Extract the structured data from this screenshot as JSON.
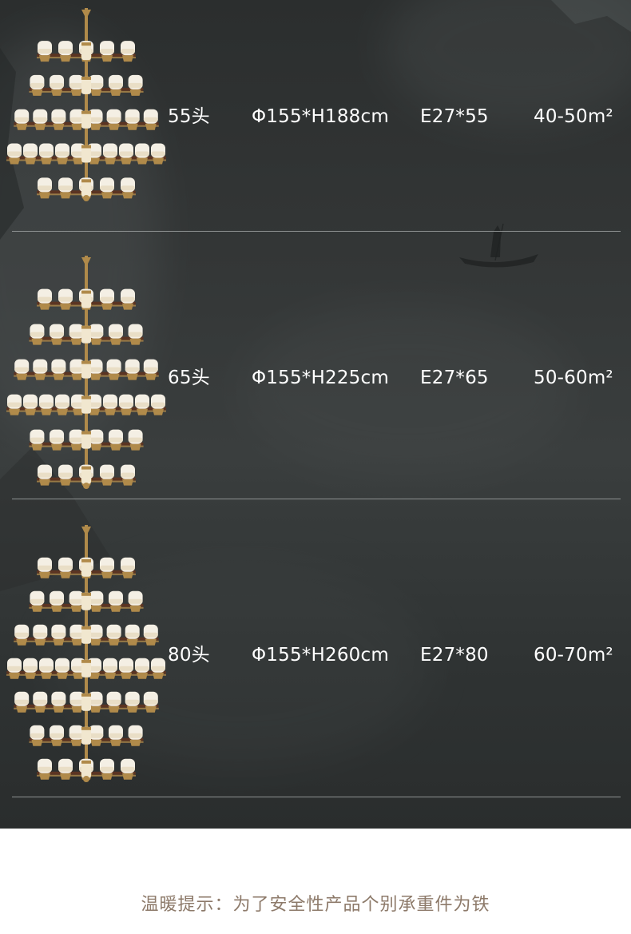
{
  "rows": [
    {
      "heads": "55头",
      "size": "Φ155*H188cm",
      "bulb": "E27*55",
      "area": "40-50m²",
      "tiers": [
        5,
        6,
        8,
        10,
        5
      ]
    },
    {
      "heads": "65头",
      "size": "Φ155*H225cm",
      "bulb": "E27*65",
      "area": "50-60m²",
      "tiers": [
        5,
        6,
        8,
        10,
        6,
        5
      ]
    },
    {
      "heads": "80头",
      "size": "Φ155*H260cm",
      "bulb": "E27*80",
      "area": "60-70m²",
      "tiers": [
        5,
        6,
        8,
        10,
        8,
        6,
        5
      ]
    }
  ],
  "notice": "温暖提示：为了安全性产品个别承重件为铁",
  "colors": {
    "panel": "#333636",
    "text": "#ffffff",
    "divider": "#8e9292",
    "notice": "#8d7a6a",
    "shade": "#f4efe4",
    "brass": "#b08a4a",
    "wood": "#5b3422"
  },
  "icons": [
    "chandelier-image",
    "boat-silhouette-icon"
  ]
}
